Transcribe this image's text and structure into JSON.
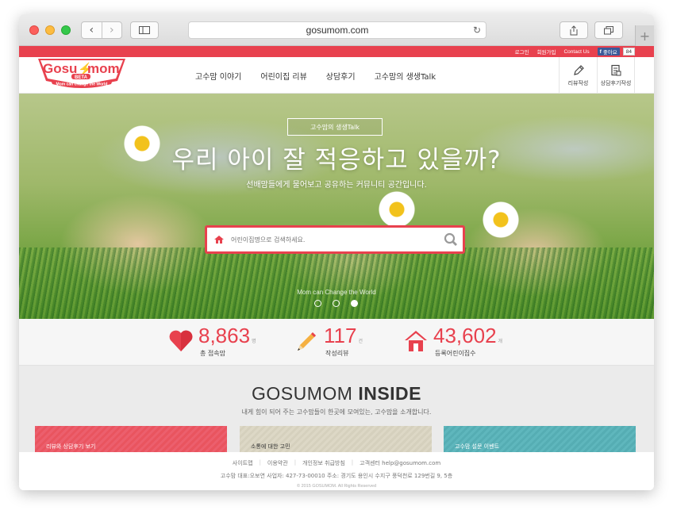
{
  "browser": {
    "url": "gosumom.com"
  },
  "site": {
    "logo": {
      "brand": "Gosu mom",
      "badge": "BETA",
      "tagline": "Mom can change the World"
    },
    "topbar": {
      "login": "로그인",
      "signup": "회원가입",
      "contact": "Contact Us",
      "like": "좋아요",
      "like_count": "84"
    },
    "nav": [
      "고수맘 이야기",
      "어린이집 리뷰",
      "상담후기",
      "고수맘의 생생Talk"
    ],
    "header_icons": [
      {
        "label": "리뷰작성",
        "icon": "pencil-icon"
      },
      {
        "label": "상담후기작성",
        "icon": "document-icon"
      }
    ],
    "hero": {
      "tag": "고수맘의 생생Talk",
      "title": "우리 아이 잘 적응하고 있을까?",
      "subtitle": "선배맘들에게 물어보고 공유하는 커뮤니티 공간입니다.",
      "search_placeholder": "어린이집명으로 검색하세요.",
      "footer_text": "Mom can Change the World",
      "slides": 3,
      "active_slide": 3
    },
    "stats": [
      {
        "value": "8,863",
        "unit": "명",
        "label": "총 접속맘",
        "icon": "heart-icon"
      },
      {
        "value": "117",
        "unit": "건",
        "label": "작성리뷰",
        "icon": "pencil-icon"
      },
      {
        "value": "43,602",
        "unit": "개",
        "label": "등록어린이집수",
        "icon": "house-icon"
      }
    ],
    "inside": {
      "title_light": "GOSUMOM",
      "title_bold": "INSIDE",
      "subtitle": "내게 힘이 되어 주는 고수맘들이 한곳에 모여있는, 고수맘을 소개합니다.",
      "cards": [
        "리뷰와 상담후기 보기",
        "소통에 대한 고민",
        "고수맘 설문 이벤트"
      ]
    },
    "footer": {
      "links": [
        "사이트맵",
        "이용약관",
        "개인정보 취급방침",
        "고객센터 help@gosumom.com"
      ],
      "info": "고수맘 대표:오보연 사업자: 427-73-00010 주소: 경기도 용인시 수지구 풍덕천로 129번길 9, 5층",
      "copyright": "© 2015 GOSUMOM. All Rights Reserved"
    },
    "colors": {
      "accent": "#e8414e"
    }
  }
}
